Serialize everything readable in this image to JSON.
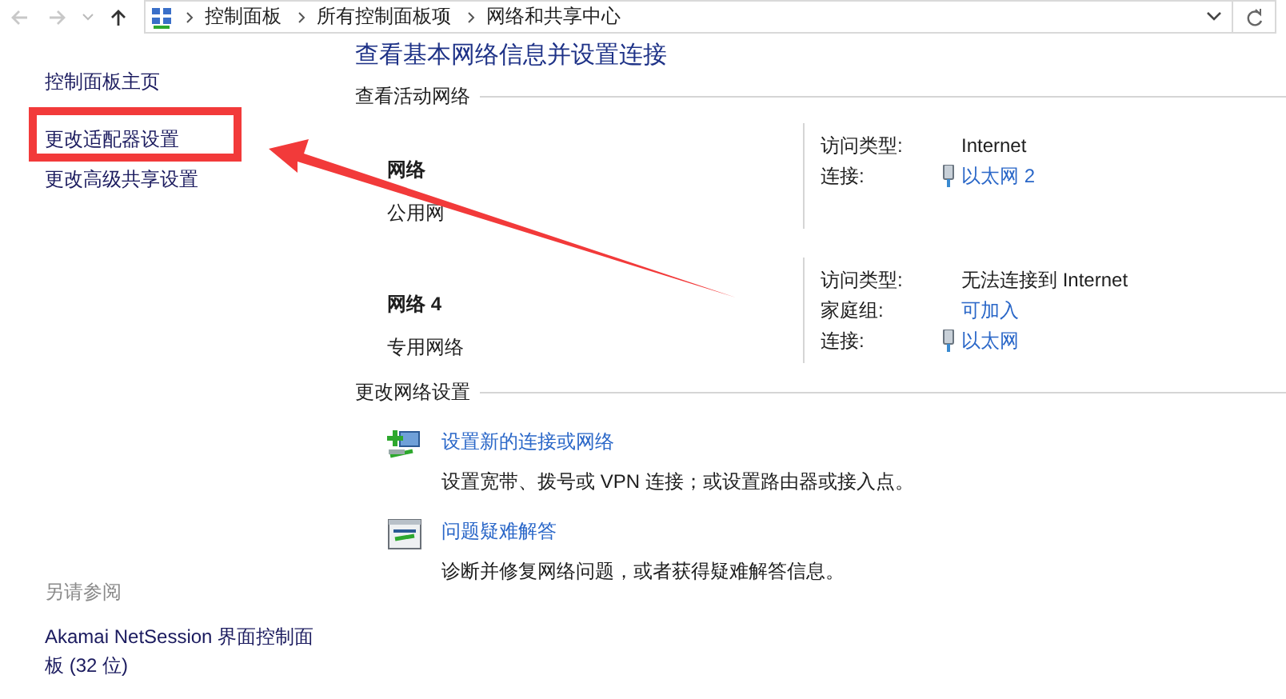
{
  "address_bar": {
    "breadcrumbs": [
      "控制面板",
      "所有控制面板项",
      "网络和共享中心"
    ]
  },
  "sidebar": {
    "links": [
      {
        "label": "控制面板主页",
        "highlighted": false
      },
      {
        "label": "更改适配器设置",
        "highlighted": true
      },
      {
        "label": "更改高级共享设置",
        "highlighted": false
      }
    ],
    "see_also": {
      "heading": "另请参阅",
      "links": [
        "Akamai NetSession 界面控制面板 (32 位)"
      ]
    }
  },
  "main": {
    "title": "查看基本网络信息并设置连接",
    "active_networks": {
      "heading": "查看活动网络",
      "networks": [
        {
          "name": "网络",
          "type": "公用网",
          "details": [
            {
              "label": "访问类型:",
              "value": "Internet",
              "kind": "text"
            },
            {
              "label": "连接:",
              "value": "以太网 2",
              "kind": "connection"
            }
          ]
        },
        {
          "name": "网络 4",
          "type": "专用网络",
          "details": [
            {
              "label": "访问类型:",
              "value": "无法连接到 Internet",
              "kind": "text"
            },
            {
              "label": "家庭组:",
              "value": "可加入",
              "kind": "link"
            },
            {
              "label": "连接:",
              "value": "以太网",
              "kind": "connection"
            }
          ]
        }
      ]
    },
    "change_settings": {
      "heading": "更改网络设置",
      "tasks": [
        {
          "kind": "new-connection",
          "title": "设置新的连接或网络",
          "description": "设置宽带、拨号或 VPN 连接；或设置路由器或接入点。"
        },
        {
          "kind": "troubleshoot",
          "title": "问题疑难解答",
          "description": "诊断并修复网络问题，或者获得疑难解答信息。"
        }
      ]
    }
  }
}
